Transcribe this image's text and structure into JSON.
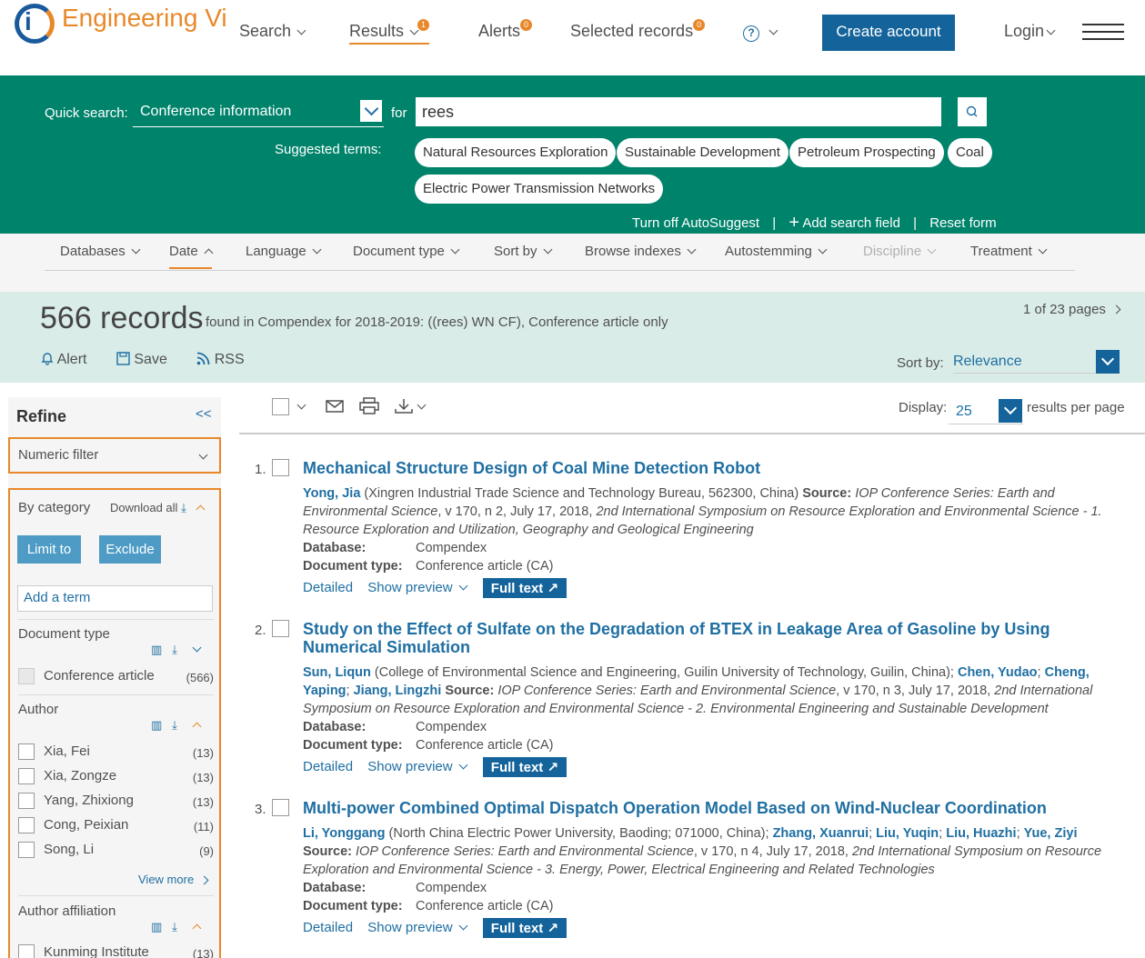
{
  "header": {
    "brand": "Engineering Vi",
    "nav": [
      {
        "label": "Search"
      },
      {
        "label": "Results",
        "badge": "1"
      },
      {
        "label": "Alerts",
        "badge": "0"
      },
      {
        "label": "Selected records",
        "badge": "0"
      }
    ],
    "help_icon": "?",
    "create_account": "Create account",
    "login": "Login"
  },
  "quick_search": {
    "label": "Quick search:",
    "field": "Conference information",
    "for_label": "for",
    "query": "rees",
    "suggested_label": "Suggested terms:",
    "suggestions": [
      "Natural Resources Exploration",
      "Sustainable Development",
      "Petroleum Prospecting",
      "Coal",
      "Electric Power Transmission Networks"
    ],
    "links": {
      "autosuggest": "Turn off AutoSuggest",
      "add_field": "Add search field",
      "reset": "Reset form"
    }
  },
  "filter_bar": [
    "Databases",
    "Date",
    "Language",
    "Document type",
    "Sort by",
    "Browse indexes",
    "Autostemming",
    "Discipline",
    "Treatment"
  ],
  "summary": {
    "count": "566 records",
    "description": "found in Compendex for 2018-2019: ((rees) WN CF), Conference article only",
    "pages": "1 of 23 pages",
    "actions": {
      "alert": "Alert",
      "save": "Save",
      "rss": "RSS"
    },
    "sort_label": "Sort by:",
    "sort_value": "Relevance"
  },
  "display": {
    "label": "Display:",
    "value": "25",
    "after": "results per page"
  },
  "refine": {
    "title": "Refine",
    "collapse": "<<",
    "numeric_filter": "Numeric filter",
    "by_category": "By category",
    "download_all": "Download all",
    "limit_to": "Limit to",
    "exclude": "Exclude",
    "add_term_placeholder": "Add a term",
    "document_type": {
      "title": "Document type",
      "items": [
        {
          "label": "Conference article",
          "count": "(566)"
        }
      ]
    },
    "author": {
      "title": "Author",
      "items": [
        {
          "label": "Xia, Fei",
          "count": "(13)"
        },
        {
          "label": "Xia, Zongze",
          "count": "(13)"
        },
        {
          "label": "Yang, Zhixiong",
          "count": "(13)"
        },
        {
          "label": "Cong, Peixian",
          "count": "(11)"
        },
        {
          "label": "Song, Li",
          "count": "(9)"
        }
      ],
      "view_more": "View more"
    },
    "affiliation": {
      "title": "Author affiliation",
      "items": [
        {
          "label": "Kunming Institute",
          "count": "(13)"
        }
      ]
    }
  },
  "results": [
    {
      "num": "1.",
      "title": "Mechanical Structure Design of Coal Mine Detection Robot",
      "authors_html": "<span class=\"auth\">Yong, Jia</span> (Xingren Industrial Trade Science and Technology Bureau, 562300, China) <b>Source:</b> <i>IOP Conference Series: Earth and Environmental Science</i>, v 170, n 2, July 17, 2018, <i>2nd International Symposium on Resource Exploration and Environmental Science - 1. Resource Exploration and Utilization, Geography and Geological Engineering</i>",
      "database": "Compendex",
      "doctype": "Conference article (CA)"
    },
    {
      "num": "2.",
      "title": "Study on the Effect of Sulfate on the Degradation of BTEX in Leakage Area of Gasoline by Using Numerical Simulation",
      "authors_html": "<span class=\"auth\">Sun, Liqun</span> (College of Environmental Science and Engineering, Guilin University of Technology, Guilin, China); <span class=\"auth\">Chen, Yudao</span>; <span class=\"auth\">Cheng, Yaping</span>; <span class=\"auth\">Jiang, Lingzhi</span> <b>Source:</b> <i>IOP Conference Series: Earth and Environmental Science</i>, v 170, n 3, July 17, 2018, <i>2nd International Symposium on Resource Exploration and Environmental Science - 2. Environmental Engineering and Sustainable Development</i>",
      "database": "Compendex",
      "doctype": "Conference article (CA)"
    },
    {
      "num": "3.",
      "title": "Multi-power Combined Optimal Dispatch Operation Model Based on Wind-Nuclear Coordination",
      "authors_html": "<span class=\"auth\">Li, Yonggang</span> (North China Electric Power University, Baoding; 071000, China); <span class=\"auth\">Zhang, Xuanrui</span>; <span class=\"auth\">Liu, Yuqin</span>; <span class=\"auth\">Liu, Huazhi</span>; <span class=\"auth\">Yue, Ziyi</span> <b>Source:</b> <i>IOP Conference Series: Earth and Environmental Science</i>, v 170, n 4, July 17, 2018, <i>2nd International Symposium on Resource Exploration and Environmental Science - 3. Energy, Power, Electrical Engineering and Related Technologies</i>",
      "database": "Compendex",
      "doctype": "Conference article (CA)"
    }
  ],
  "result_labels": {
    "database": "Database:",
    "doctype": "Document type:",
    "detailed": "Detailed",
    "preview": "Show preview",
    "fulltext": "Full text"
  }
}
